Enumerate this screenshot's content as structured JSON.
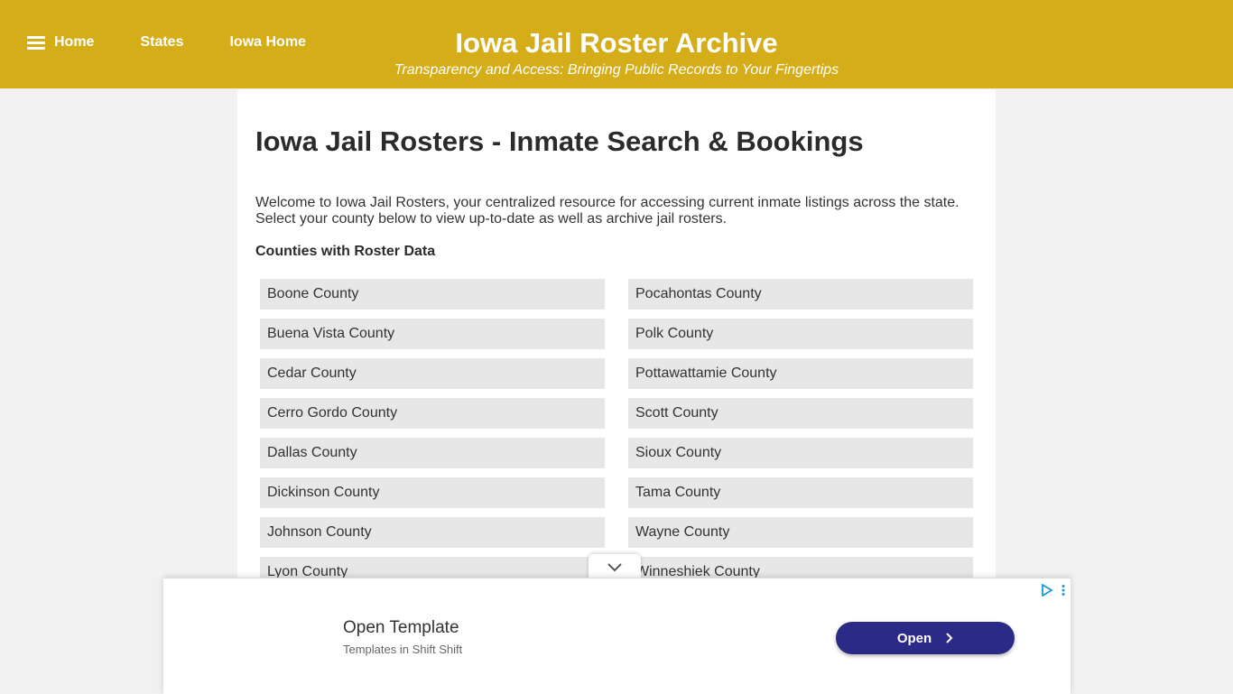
{
  "header": {
    "nav": [
      {
        "label": "Home",
        "icon": "hamburger-menu-icon"
      },
      {
        "label": "States"
      },
      {
        "label": "Iowa Home"
      }
    ],
    "title": "Iowa Jail Roster Archive",
    "tagline": "Transparency and Access: Bringing Public Records to Your Fingertips",
    "color": "#d4ad19"
  },
  "main": {
    "title": "Iowa Jail Rosters - Inmate Search & Bookings",
    "intro": "Welcome to Iowa Jail Rosters, your centralized resource for accessing current inmate listings across the state. Select your county below to view up-to-date as well as archive jail rosters.",
    "section_title": "Counties with Roster Data",
    "counties_left": [
      "Boone County",
      "Buena Vista County",
      "Cedar County",
      "Cerro Gordo County",
      "Dallas County",
      "Dickinson County",
      "Johnson County",
      "Lyon County"
    ],
    "counties_right": [
      "Pocahontas County",
      "Polk County",
      "Pottawattamie County",
      "Scott County",
      "Sioux County",
      "Tama County",
      "Wayne County",
      "Winneshiek County"
    ]
  },
  "ad": {
    "title": "Open Template",
    "subtitle": "Templates in Shift Shift",
    "button_label": "Open",
    "button_color": "#2c2a87",
    "icons": [
      "chevron-down-icon",
      "adchoices-icon",
      "more-vert-icon",
      "chevron-right-icon"
    ]
  }
}
